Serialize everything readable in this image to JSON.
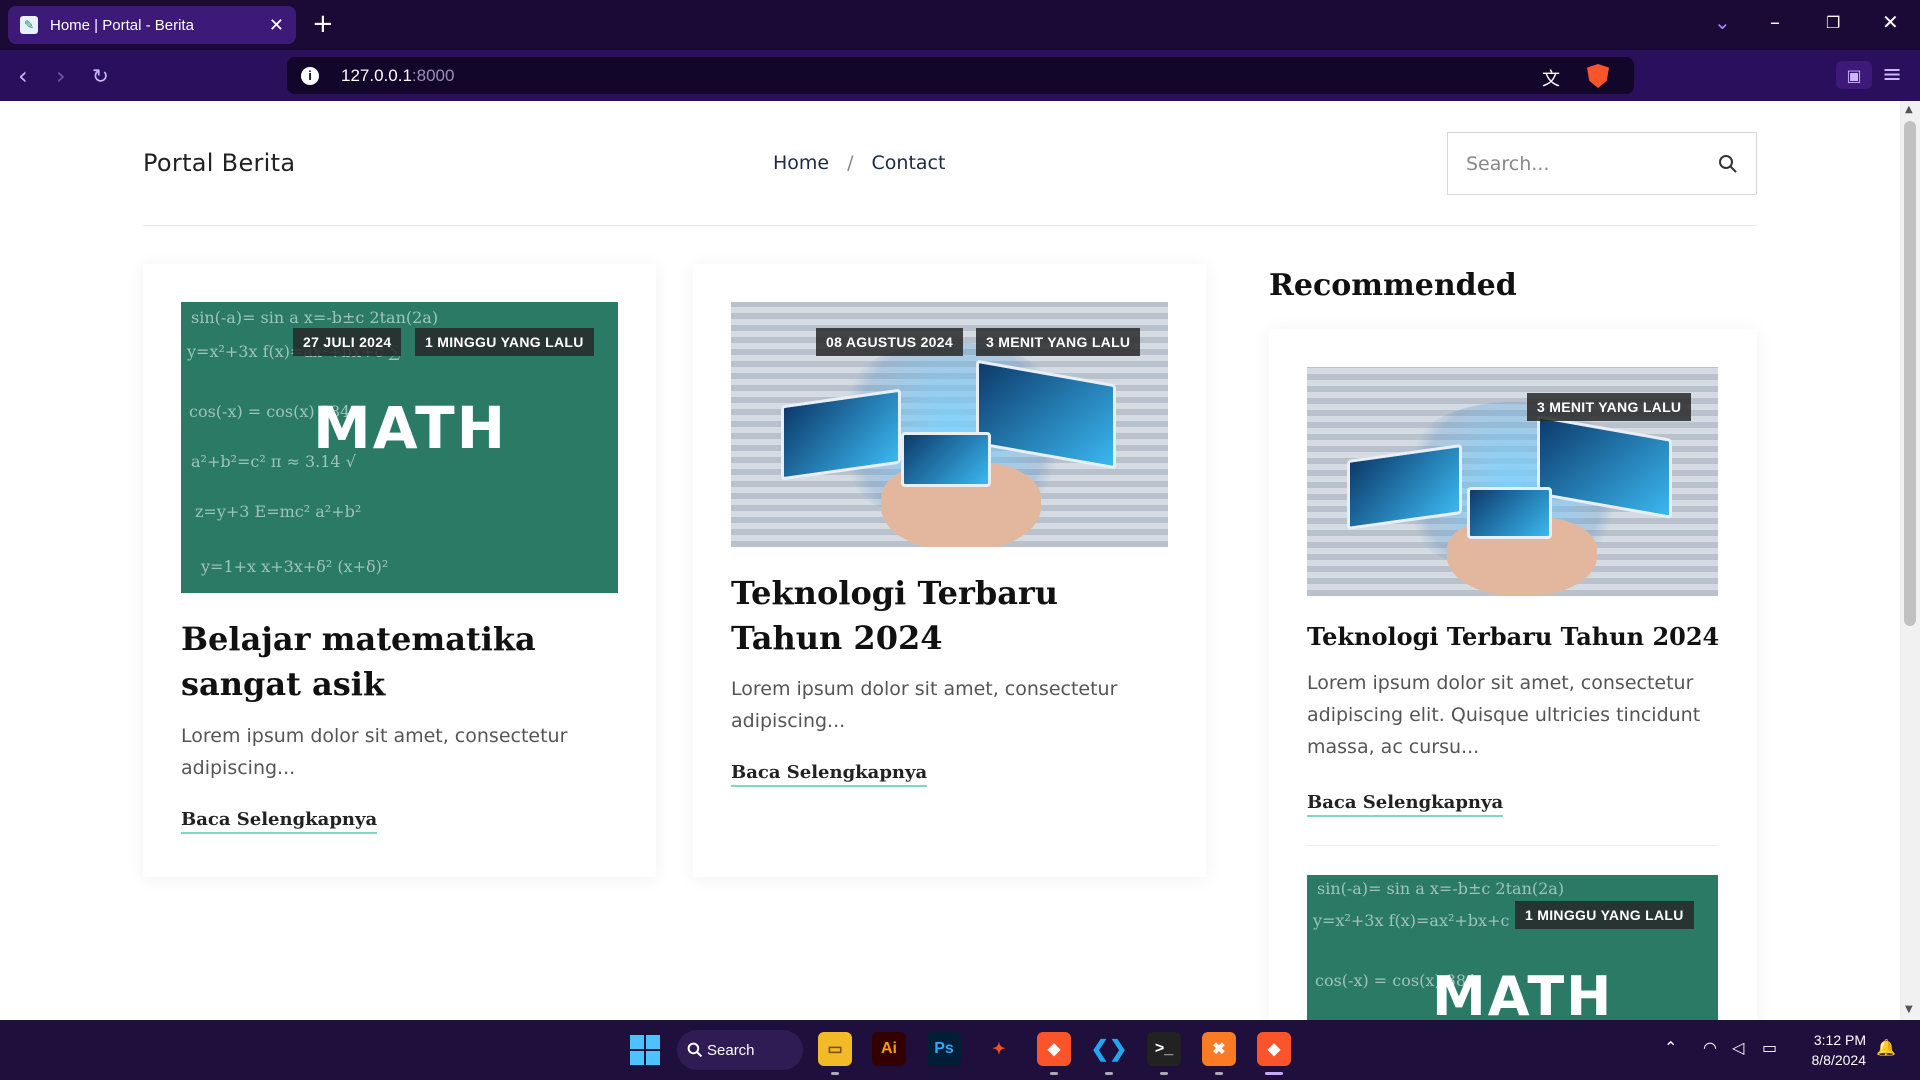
{
  "browser": {
    "tab_title": "Home | Portal - Berita",
    "url_host": "127.0.0.1",
    "url_port": ":8000"
  },
  "site": {
    "brand": "Portal Berita",
    "nav": [
      "Home",
      "/",
      "Contact"
    ],
    "search_placeholder": "Search..."
  },
  "posts": [
    {
      "date": "27 JULI 2024",
      "ago": "1 MINGGU YANG LALU",
      "title": "Belajar matematika sangat asik",
      "excerpt": "Lorem ipsum dolor sit amet, consectetur adipiscing...",
      "read_more": "Baca Selengkapnya",
      "image_text": "MATH"
    },
    {
      "date": "08 AGUSTUS 2024",
      "ago": "3 MENIT YANG LALU",
      "title": "Teknologi Terbaru Tahun 2024",
      "excerpt": "Lorem ipsum dolor sit amet, consectetur adipiscing...",
      "read_more": "Baca Selengkapnya"
    }
  ],
  "recommended": {
    "heading": "Recommended",
    "items": [
      {
        "ago": "3 MENIT YANG LALU",
        "title": "Teknologi Terbaru Tahun 2024",
        "excerpt": "Lorem ipsum dolor sit amet, consectetur adipiscing elit. Quisque ultricies tincidunt massa, ac cursu...",
        "read_more": "Baca Selengkapnya"
      },
      {
        "ago": "1 MINGGU YANG LALU",
        "image_text": "MATH"
      }
    ]
  },
  "taskbar": {
    "search_label": "Search",
    "time": "3:12 PM",
    "date": "8/8/2024"
  },
  "colors": {
    "chrome_dark": "#1a0a35",
    "chrome_purple": "#2a0f5c",
    "accent_underline": "#7fd8c6",
    "chalkboard": "#2a7a66"
  }
}
